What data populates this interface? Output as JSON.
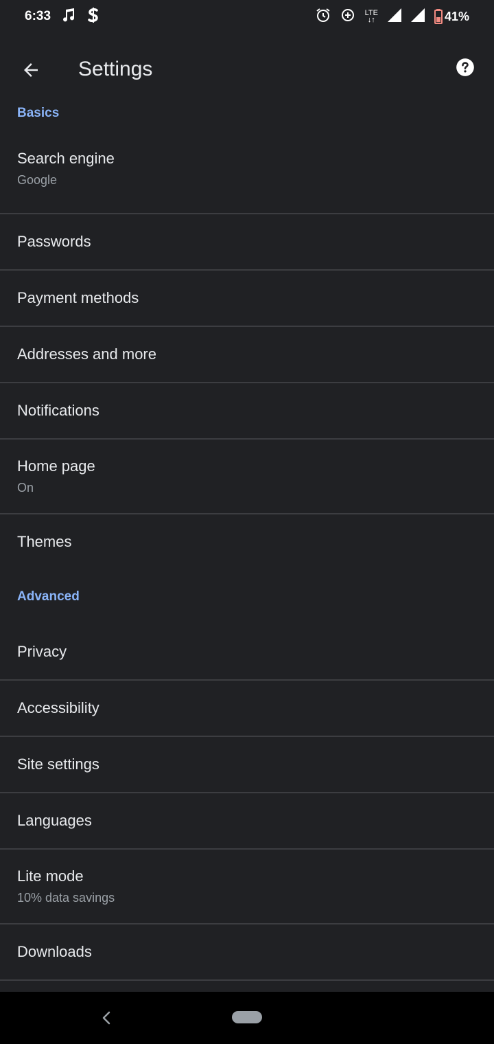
{
  "status_bar": {
    "time": "6:33",
    "network": "LTE",
    "battery": "41%",
    "icons": [
      "music-note-icon",
      "s-app-icon",
      "alarm-icon",
      "data-saver-icon",
      "signal-icon",
      "signal-icon",
      "battery-icon"
    ]
  },
  "app_bar": {
    "title": "Settings",
    "back_icon": "arrow-back-icon",
    "help_icon": "help-icon"
  },
  "sections": {
    "basics": "Basics",
    "advanced": "Advanced"
  },
  "items": {
    "search_engine": {
      "title": "Search engine",
      "subtitle": "Google"
    },
    "passwords": {
      "title": "Passwords"
    },
    "payment_methods": {
      "title": "Payment methods"
    },
    "addresses": {
      "title": "Addresses and more"
    },
    "notifications": {
      "title": "Notifications"
    },
    "home_page": {
      "title": "Home page",
      "subtitle": "On"
    },
    "themes": {
      "title": "Themes"
    },
    "privacy": {
      "title": "Privacy"
    },
    "accessibility": {
      "title": "Accessibility"
    },
    "site_settings": {
      "title": "Site settings"
    },
    "languages": {
      "title": "Languages"
    },
    "lite_mode": {
      "title": "Lite mode",
      "subtitle": "10% data savings"
    },
    "downloads": {
      "title": "Downloads"
    }
  },
  "colors": {
    "background": "#202124",
    "accent": "#8ab4f8",
    "divider": "#3c3d41",
    "battery_low": "#f28b82"
  }
}
